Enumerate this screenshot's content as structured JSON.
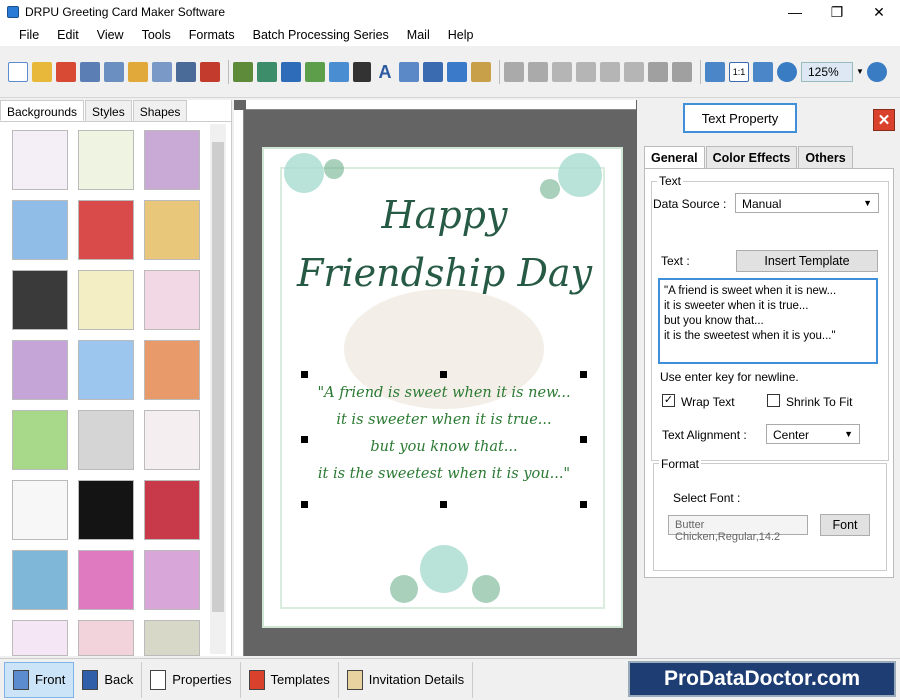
{
  "window": {
    "title": "DRPU Greeting Card Maker Software",
    "minimize": "—",
    "restore": "❐",
    "close": "✕"
  },
  "menu": [
    "File",
    "Edit",
    "View",
    "Tools",
    "Formats",
    "Batch Processing Series",
    "Mail",
    "Help"
  ],
  "toolbar": {
    "zoom_value": "125%"
  },
  "left_panel": {
    "tabs": [
      "Backgrounds",
      "Styles",
      "Shapes"
    ],
    "active_tab": "Backgrounds"
  },
  "card": {
    "heading_line1": "Happy",
    "heading_line2": "Friendship Day",
    "text_lines": [
      "\"A friend is sweet when it is new...",
      "it is sweeter when it is true...",
      "but you know that...",
      "it is the sweetest when it is you...\""
    ]
  },
  "right_panel": {
    "header_button": "Text Property",
    "close": "✕",
    "tabs": [
      "General",
      "Color Effects",
      "Others"
    ],
    "active_tab": "General",
    "text_group": "Text",
    "data_source_label": "Data Source :",
    "data_source_value": "Manual",
    "text_label": "Text :",
    "insert_template": "Insert Template",
    "textarea": "\"A friend is sweet when it is new...\nit is sweeter when it is true...\nbut you know that...\nit is the sweetest when it is you...\"",
    "hint": "Use enter key for newline.",
    "wrap_text": "Wrap Text",
    "wrap_text_checked": "✓",
    "shrink_to_fit": "Shrink To Fit",
    "text_alignment_label": "Text Alignment :",
    "text_alignment_value": "Center",
    "format_group": "Format",
    "select_font_label": "Select Font :",
    "font_value": "Butter Chicken,Regular,14.2",
    "font_button": "Font"
  },
  "bottom": {
    "buttons": [
      "Front",
      "Back",
      "Properties",
      "Templates",
      "Invitation Details"
    ],
    "active": "Front",
    "brand": "ProDataDoctor.com"
  }
}
